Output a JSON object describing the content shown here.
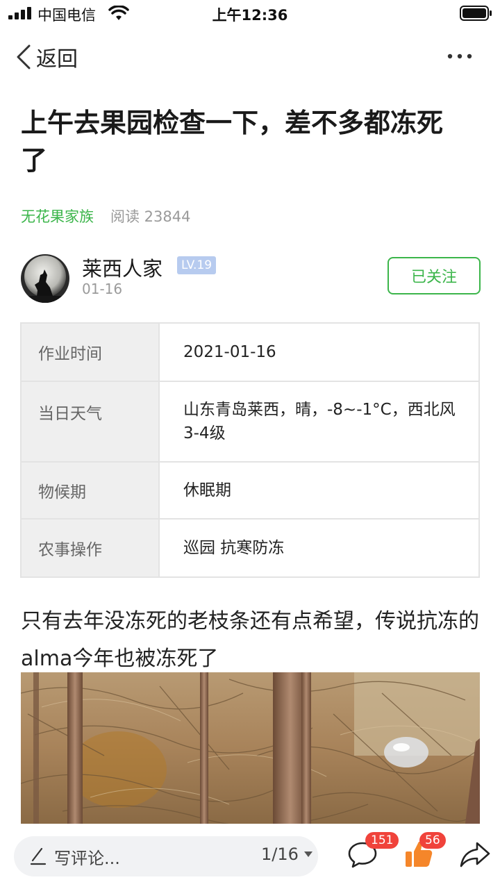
{
  "status_bar": {
    "carrier": "中国电信",
    "time": "上午12:36"
  },
  "nav": {
    "back_label": "返回"
  },
  "article": {
    "title": "上午去果园检查一下，差不多都冻死了",
    "topic": "无花果家族",
    "read_label": "阅读 23844"
  },
  "author": {
    "name": "莱西人家",
    "level": "LV.19",
    "date": "01-16",
    "follow_label": "已关注"
  },
  "info_table": [
    {
      "label": "作业时间",
      "value": "2021-01-16"
    },
    {
      "label": "当日天气",
      "value": "山东青岛莱西，晴，-8~-1°C，西北风 3-4级"
    },
    {
      "label": "物候期",
      "value": "休眠期"
    },
    {
      "label": "农事操作",
      "value": "巡园 抗寒防冻"
    }
  ],
  "body_text": "只有去年没冻死的老枝条还有点希望，传说抗冻的alma今年也被冻死了",
  "bottom_bar": {
    "comment_placeholder": "写评论...",
    "page_indicator": "1/16",
    "comment_count": "151",
    "like_count": "56"
  },
  "colors": {
    "accent_green": "#3bb54a",
    "badge_red": "#f0433b",
    "like_orange": "#f5862a",
    "level_badge_blue": "#b7cbef"
  },
  "icons": [
    "signal-icon",
    "wifi-icon",
    "battery-icon",
    "back-chevron-icon",
    "more-icon",
    "pen-icon",
    "caret-down-icon",
    "comment-icon",
    "thumbs-up-icon",
    "share-icon"
  ]
}
